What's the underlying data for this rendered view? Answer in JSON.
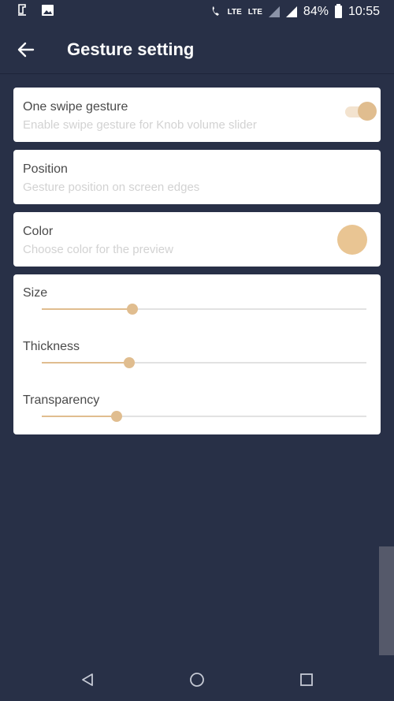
{
  "status_bar": {
    "lte1": "LTE",
    "lte2": "LTE",
    "battery": "84%",
    "time": "10:55"
  },
  "toolbar": {
    "title": "Gesture setting",
    "back_icon": "arrow-left-icon"
  },
  "settings": {
    "swipe": {
      "title": "One swipe gesture",
      "subtitle": "Enable swipe gesture for Knob volume slider",
      "enabled": true
    },
    "position": {
      "title": "Position",
      "subtitle": "Gesture position on screen edges"
    },
    "color": {
      "title": "Color",
      "subtitle": "Choose color for the preview",
      "value": "#e9c593"
    },
    "sliders": [
      {
        "label": "Size",
        "value": 0.28
      },
      {
        "label": "Thickness",
        "value": 0.27
      },
      {
        "label": "Transparency",
        "value": 0.23
      }
    ]
  },
  "colors": {
    "background": "#283047",
    "accent": "#e0bd8f",
    "card": "#ffffff"
  },
  "navbar": {
    "back_icon": "triangle-back-icon",
    "home_icon": "circle-home-icon",
    "recents_icon": "square-recents-icon"
  }
}
